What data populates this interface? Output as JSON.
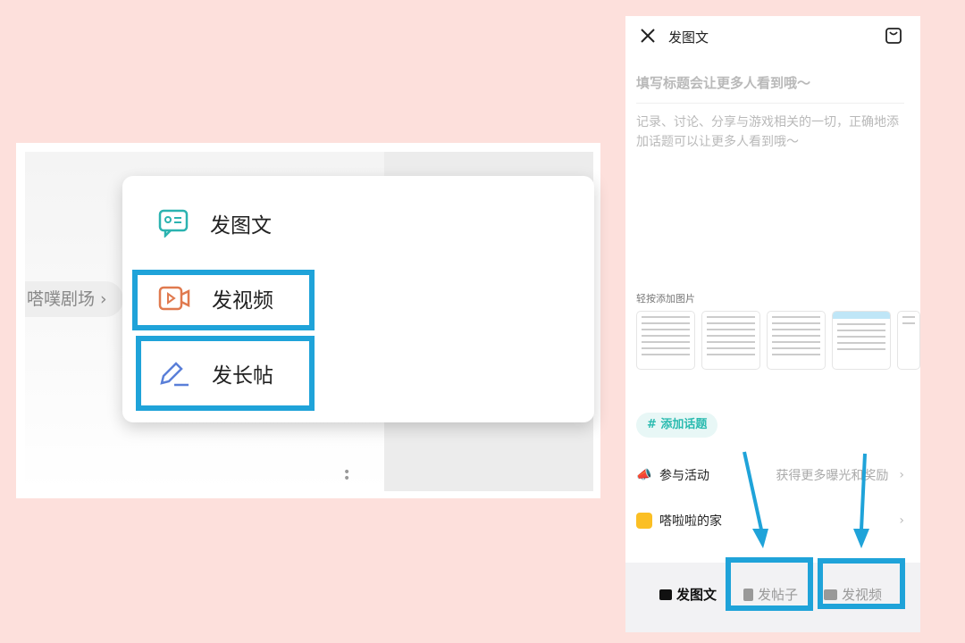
{
  "left_panel": {
    "chip": "嗒噗剧场 ›",
    "menu": [
      {
        "icon": "image-text-icon",
        "label": "发图文"
      },
      {
        "icon": "video-icon",
        "label": "发视频"
      },
      {
        "icon": "pen-icon",
        "label": "发长帖"
      }
    ]
  },
  "right_panel": {
    "header": {
      "title": "发图文",
      "close_icon": "close-icon",
      "draft_icon": "draft-box-icon"
    },
    "title_placeholder": "填写标题会让更多人看到哦～",
    "body_placeholder": "记录、讨论、分享与游戏相关的一切，正确地添加话题可以让更多人看到哦～",
    "add_image_label": "轻按添加图片",
    "topic_button": "# 添加话题",
    "rows": [
      {
        "label": "参与活动",
        "hint": "获得更多曝光和奖励"
      },
      {
        "label": "嗒啦啦的家",
        "hint": ""
      }
    ],
    "tabs": [
      {
        "label": "发图文",
        "active": true
      },
      {
        "label": "发帖子",
        "active": false
      },
      {
        "label": "发视频",
        "active": false
      }
    ]
  },
  "colors": {
    "highlight": "#1fa3d9",
    "accent": "#2bbbb0",
    "background": "#fde0dc"
  }
}
